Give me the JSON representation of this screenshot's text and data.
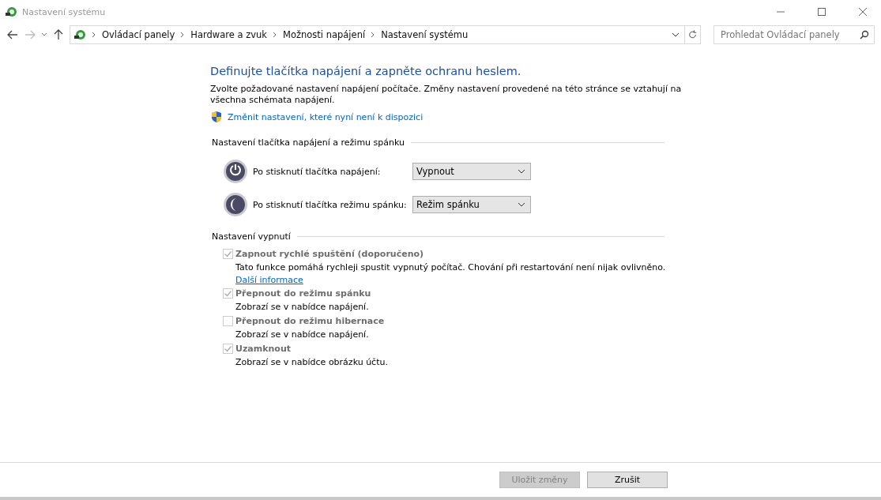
{
  "window": {
    "title": "Nastavení systému"
  },
  "breadcrumb": [
    "Ovládací panely",
    "Hardware a zvuk",
    "Možnosti napájení",
    "Nastavení systému"
  ],
  "search": {
    "placeholder": "Prohledat Ovládací panely"
  },
  "heading": "Definujte tlačítka napájení a zapněte ochranu heslem.",
  "intro": "Zvolte požadované nastavení napájení počítače. Změny nastavení provedené na této stránce se vztahují na všechna schémata napájení.",
  "admin_link": "Změnit nastavení, které nyní není k dispozici",
  "button_section": {
    "title": "Nastavení tlačítka napájení a režimu spánku",
    "rows": [
      {
        "kind": "power",
        "label": "Po stisknutí tlačítka napájení:",
        "value": "Vypnout"
      },
      {
        "kind": "sleep",
        "label": "Po stisknutí tlačítka režimu spánku:",
        "value": "Režim spánku"
      }
    ]
  },
  "shutdown_section": {
    "title": "Nastavení vypnutí",
    "options": [
      {
        "label": "Zapnout rychlé spuštění (doporučeno)",
        "checked": true,
        "disabled": true,
        "description": "Tato funkce pomáhá rychleji spustit vypnutý počítač. Chování při restartování není nijak ovlivněno.",
        "link": "Další informace"
      },
      {
        "label": "Přepnout do režimu spánku",
        "checked": true,
        "disabled": true,
        "description": "Zobrazí se v nabídce napájení."
      },
      {
        "label": "Přepnout do režimu hibernace",
        "checked": false,
        "disabled": true,
        "description": "Zobrazí se v nabídce napájení."
      },
      {
        "label": "Uzamknout",
        "checked": true,
        "disabled": true,
        "description": "Zobrazí se v nabídce obrázku účtu."
      }
    ]
  },
  "buttons": [
    {
      "label": "Uložit změny",
      "disabled": true
    },
    {
      "label": "Zrušit",
      "disabled": false
    }
  ]
}
